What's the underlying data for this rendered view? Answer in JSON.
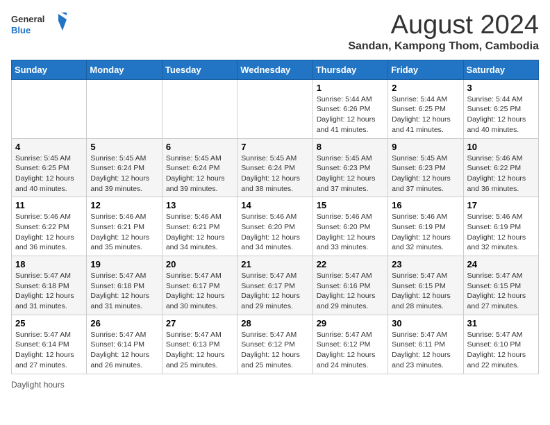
{
  "header": {
    "logo_general": "General",
    "logo_blue": "Blue",
    "month_title": "August 2024",
    "location": "Sandan, Kampong Thom, Cambodia"
  },
  "days_of_week": [
    "Sunday",
    "Monday",
    "Tuesday",
    "Wednesday",
    "Thursday",
    "Friday",
    "Saturday"
  ],
  "footer": {
    "daylight_label": "Daylight hours"
  },
  "weeks": [
    {
      "days": [
        {
          "date": "",
          "sunrise": "",
          "sunset": "",
          "daylight": ""
        },
        {
          "date": "",
          "sunrise": "",
          "sunset": "",
          "daylight": ""
        },
        {
          "date": "",
          "sunrise": "",
          "sunset": "",
          "daylight": ""
        },
        {
          "date": "",
          "sunrise": "",
          "sunset": "",
          "daylight": ""
        },
        {
          "date": "1",
          "sunrise": "Sunrise: 5:44 AM",
          "sunset": "Sunset: 6:26 PM",
          "daylight": "Daylight: 12 hours and 41 minutes."
        },
        {
          "date": "2",
          "sunrise": "Sunrise: 5:44 AM",
          "sunset": "Sunset: 6:25 PM",
          "daylight": "Daylight: 12 hours and 41 minutes."
        },
        {
          "date": "3",
          "sunrise": "Sunrise: 5:44 AM",
          "sunset": "Sunset: 6:25 PM",
          "daylight": "Daylight: 12 hours and 40 minutes."
        }
      ]
    },
    {
      "days": [
        {
          "date": "4",
          "sunrise": "Sunrise: 5:45 AM",
          "sunset": "Sunset: 6:25 PM",
          "daylight": "Daylight: 12 hours and 40 minutes."
        },
        {
          "date": "5",
          "sunrise": "Sunrise: 5:45 AM",
          "sunset": "Sunset: 6:24 PM",
          "daylight": "Daylight: 12 hours and 39 minutes."
        },
        {
          "date": "6",
          "sunrise": "Sunrise: 5:45 AM",
          "sunset": "Sunset: 6:24 PM",
          "daylight": "Daylight: 12 hours and 39 minutes."
        },
        {
          "date": "7",
          "sunrise": "Sunrise: 5:45 AM",
          "sunset": "Sunset: 6:24 PM",
          "daylight": "Daylight: 12 hours and 38 minutes."
        },
        {
          "date": "8",
          "sunrise": "Sunrise: 5:45 AM",
          "sunset": "Sunset: 6:23 PM",
          "daylight": "Daylight: 12 hours and 37 minutes."
        },
        {
          "date": "9",
          "sunrise": "Sunrise: 5:45 AM",
          "sunset": "Sunset: 6:23 PM",
          "daylight": "Daylight: 12 hours and 37 minutes."
        },
        {
          "date": "10",
          "sunrise": "Sunrise: 5:46 AM",
          "sunset": "Sunset: 6:22 PM",
          "daylight": "Daylight: 12 hours and 36 minutes."
        }
      ]
    },
    {
      "days": [
        {
          "date": "11",
          "sunrise": "Sunrise: 5:46 AM",
          "sunset": "Sunset: 6:22 PM",
          "daylight": "Daylight: 12 hours and 36 minutes."
        },
        {
          "date": "12",
          "sunrise": "Sunrise: 5:46 AM",
          "sunset": "Sunset: 6:21 PM",
          "daylight": "Daylight: 12 hours and 35 minutes."
        },
        {
          "date": "13",
          "sunrise": "Sunrise: 5:46 AM",
          "sunset": "Sunset: 6:21 PM",
          "daylight": "Daylight: 12 hours and 34 minutes."
        },
        {
          "date": "14",
          "sunrise": "Sunrise: 5:46 AM",
          "sunset": "Sunset: 6:20 PM",
          "daylight": "Daylight: 12 hours and 34 minutes."
        },
        {
          "date": "15",
          "sunrise": "Sunrise: 5:46 AM",
          "sunset": "Sunset: 6:20 PM",
          "daylight": "Daylight: 12 hours and 33 minutes."
        },
        {
          "date": "16",
          "sunrise": "Sunrise: 5:46 AM",
          "sunset": "Sunset: 6:19 PM",
          "daylight": "Daylight: 12 hours and 32 minutes."
        },
        {
          "date": "17",
          "sunrise": "Sunrise: 5:46 AM",
          "sunset": "Sunset: 6:19 PM",
          "daylight": "Daylight: 12 hours and 32 minutes."
        }
      ]
    },
    {
      "days": [
        {
          "date": "18",
          "sunrise": "Sunrise: 5:47 AM",
          "sunset": "Sunset: 6:18 PM",
          "daylight": "Daylight: 12 hours and 31 minutes."
        },
        {
          "date": "19",
          "sunrise": "Sunrise: 5:47 AM",
          "sunset": "Sunset: 6:18 PM",
          "daylight": "Daylight: 12 hours and 31 minutes."
        },
        {
          "date": "20",
          "sunrise": "Sunrise: 5:47 AM",
          "sunset": "Sunset: 6:17 PM",
          "daylight": "Daylight: 12 hours and 30 minutes."
        },
        {
          "date": "21",
          "sunrise": "Sunrise: 5:47 AM",
          "sunset": "Sunset: 6:17 PM",
          "daylight": "Daylight: 12 hours and 29 minutes."
        },
        {
          "date": "22",
          "sunrise": "Sunrise: 5:47 AM",
          "sunset": "Sunset: 6:16 PM",
          "daylight": "Daylight: 12 hours and 29 minutes."
        },
        {
          "date": "23",
          "sunrise": "Sunrise: 5:47 AM",
          "sunset": "Sunset: 6:15 PM",
          "daylight": "Daylight: 12 hours and 28 minutes."
        },
        {
          "date": "24",
          "sunrise": "Sunrise: 5:47 AM",
          "sunset": "Sunset: 6:15 PM",
          "daylight": "Daylight: 12 hours and 27 minutes."
        }
      ]
    },
    {
      "days": [
        {
          "date": "25",
          "sunrise": "Sunrise: 5:47 AM",
          "sunset": "Sunset: 6:14 PM",
          "daylight": "Daylight: 12 hours and 27 minutes."
        },
        {
          "date": "26",
          "sunrise": "Sunrise: 5:47 AM",
          "sunset": "Sunset: 6:14 PM",
          "daylight": "Daylight: 12 hours and 26 minutes."
        },
        {
          "date": "27",
          "sunrise": "Sunrise: 5:47 AM",
          "sunset": "Sunset: 6:13 PM",
          "daylight": "Daylight: 12 hours and 25 minutes."
        },
        {
          "date": "28",
          "sunrise": "Sunrise: 5:47 AM",
          "sunset": "Sunset: 6:12 PM",
          "daylight": "Daylight: 12 hours and 25 minutes."
        },
        {
          "date": "29",
          "sunrise": "Sunrise: 5:47 AM",
          "sunset": "Sunset: 6:12 PM",
          "daylight": "Daylight: 12 hours and 24 minutes."
        },
        {
          "date": "30",
          "sunrise": "Sunrise: 5:47 AM",
          "sunset": "Sunset: 6:11 PM",
          "daylight": "Daylight: 12 hours and 23 minutes."
        },
        {
          "date": "31",
          "sunrise": "Sunrise: 5:47 AM",
          "sunset": "Sunset: 6:10 PM",
          "daylight": "Daylight: 12 hours and 22 minutes."
        }
      ]
    }
  ]
}
